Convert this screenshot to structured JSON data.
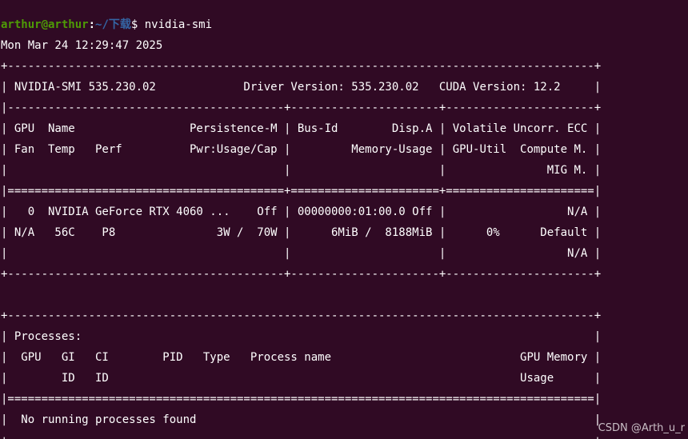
{
  "prompt": {
    "user_host": "arthur@arthur",
    "separator": ":",
    "path": "~/下载",
    "dollar": "$ ",
    "command": "nvidia-smi"
  },
  "output": {
    "timestamp": "Mon Mar 24 12:29:47 2025",
    "gpu_table": {
      "top_border": "+---------------------------------------------------------------------------------------+",
      "header_line": "| NVIDIA-SMI 535.230.02             Driver Version: 535.230.02   CUDA Version: 12.2     |",
      "header_divider": "|-----------------------------------------+----------------------+----------------------+",
      "column_header_rows": [
        "| GPU  Name                 Persistence-M | Bus-Id        Disp.A | Volatile Uncorr. ECC |",
        "| Fan  Temp   Perf          Pwr:Usage/Cap |         Memory-Usage | GPU-Util  Compute M. |",
        "|                                         |                      |               MIG M. |"
      ],
      "column_divider": "|=========================================+======================+======================|",
      "gpu_rows": [
        "|   0  NVIDIA GeForce RTX 4060 ...    Off | 00000000:01:00.0 Off |                  N/A |",
        "| N/A   56C    P8               3W /  70W |      6MiB /  8188MiB |      0%      Default |",
        "|                                         |                      |                  N/A |"
      ],
      "bottom_border": "+-----------------------------------------+----------------------+----------------------+"
    },
    "process_table": {
      "top_border": "+---------------------------------------------------------------------------------------+",
      "title_line": "| Processes:                                                                            |",
      "column_header_rows": [
        "|  GPU   GI   CI        PID   Type   Process name                            GPU Memory |",
        "|        ID   ID                                                             Usage      |"
      ],
      "column_divider": "|=======================================================================================|",
      "message_line": "|  No running processes found                                                           |",
      "bottom_border": "+---------------------------------------------------------------------------------------+"
    }
  },
  "watermark": "CSDN @Arth_u_r"
}
